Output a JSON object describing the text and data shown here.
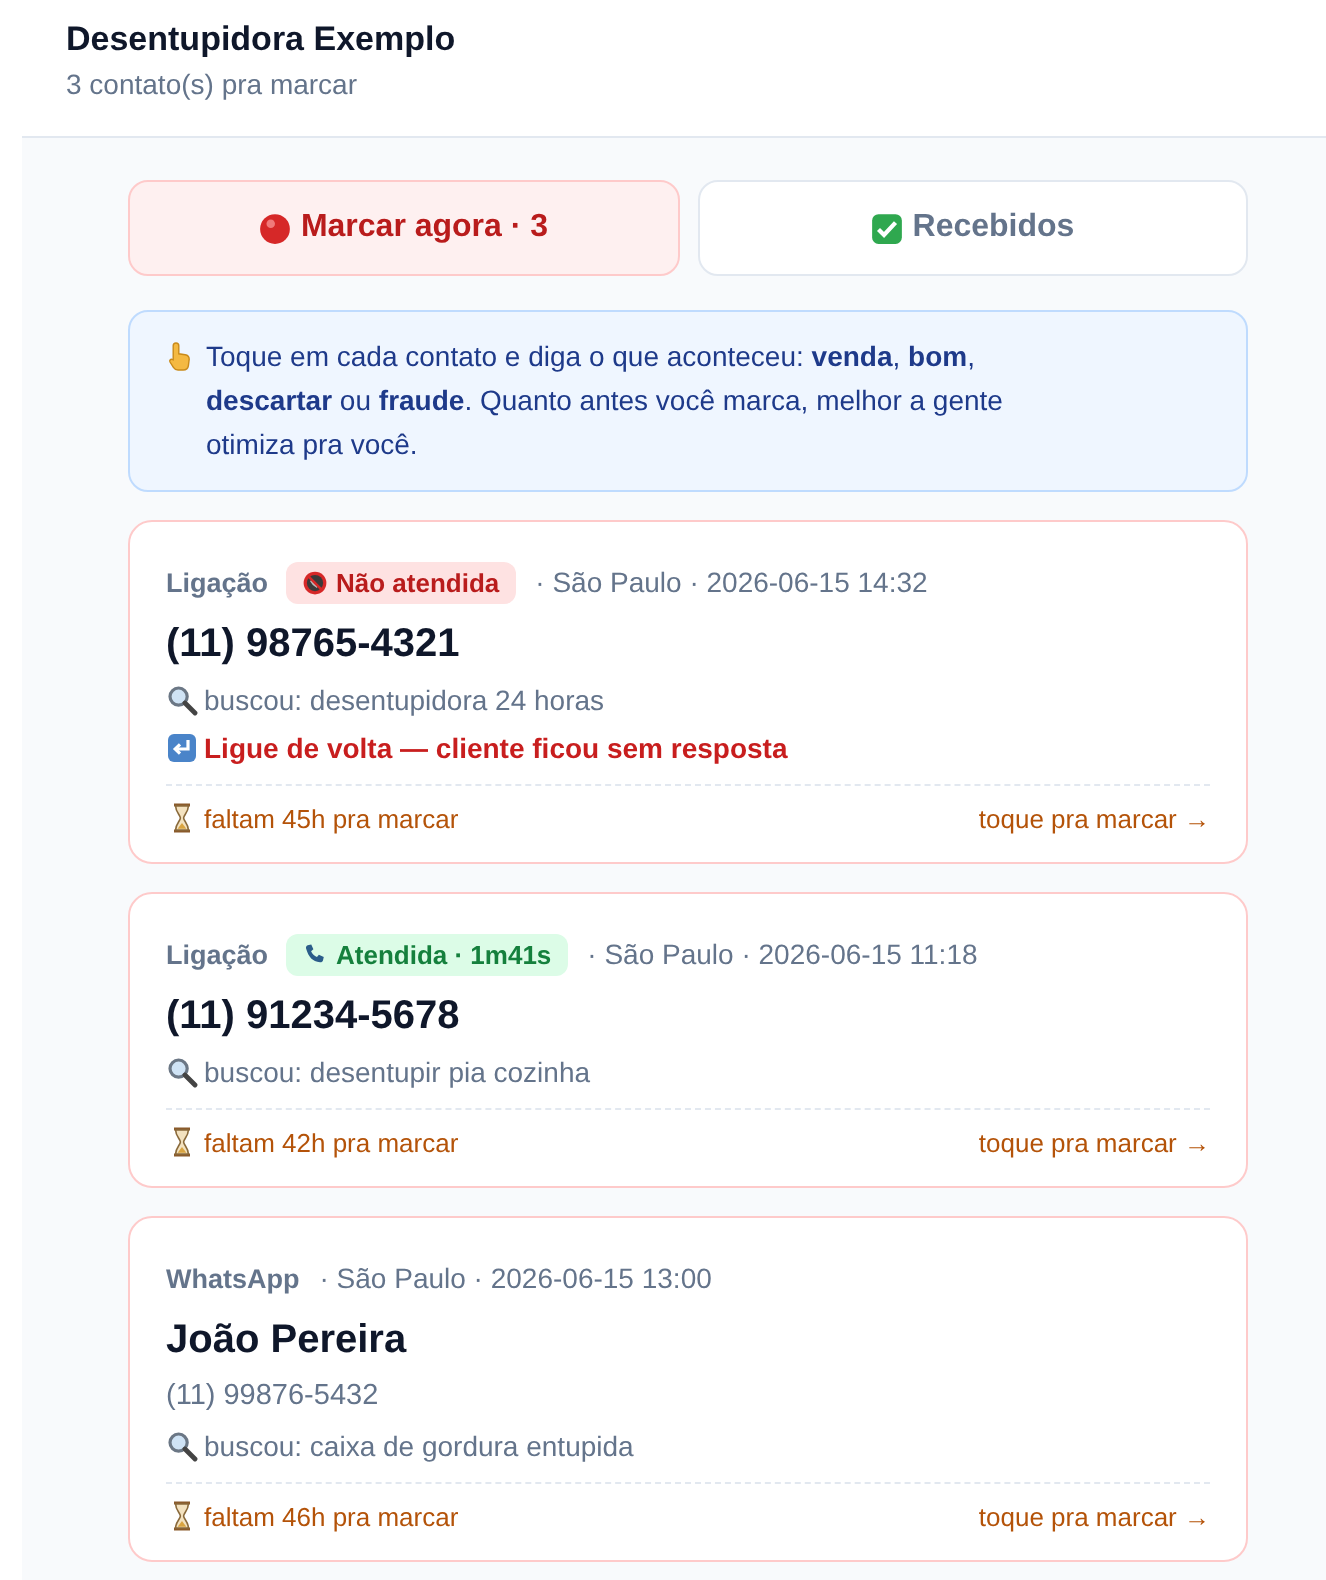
{
  "header": {
    "title": "Desentupidora Exemplo",
    "subtitle": "3 contato(s) pra marcar"
  },
  "tabs": [
    {
      "label": "Marcar agora · 3",
      "kind": "pending",
      "selected": true
    },
    {
      "label": "Recebidos",
      "kind": "done",
      "selected": false
    }
  ],
  "info": {
    "text": "Toque em cada contato e diga o que aconteceu: **venda**, **bom**, **descartar** ou **fraude**. Quanto antes você marca, melhor a gente otimiza pra você."
  },
  "contacts": [
    {
      "channel": "Ligação",
      "status": {
        "kind": "missed",
        "label": "Não atendida"
      },
      "meta": "· São Paulo · 2026-06-15 14:32",
      "title": "(11) 98765-4321",
      "search": "buscou: desentupidora 24 horas",
      "alert": "Ligue de volta — cliente ficou sem resposta",
      "deadline": "faltam 45h pra marcar",
      "action": "toque pra marcar →"
    },
    {
      "channel": "Ligação",
      "status": {
        "kind": "answered",
        "label": "Atendida · 1m41s"
      },
      "meta": "· São Paulo · 2026-06-15 11:18",
      "title": "(11) 91234-5678",
      "search": "buscou: desentupir pia cozinha",
      "deadline": "faltam 42h pra marcar",
      "action": "toque pra marcar →"
    },
    {
      "channel": "WhatsApp",
      "meta": "· São Paulo · 2026-06-15 13:00",
      "title": "João Pereira",
      "phone": "(11) 99876-5432",
      "search": "buscou: caixa de gordura entupida",
      "deadline": "faltam 46h pra marcar",
      "action": "toque pra marcar →"
    }
  ]
}
